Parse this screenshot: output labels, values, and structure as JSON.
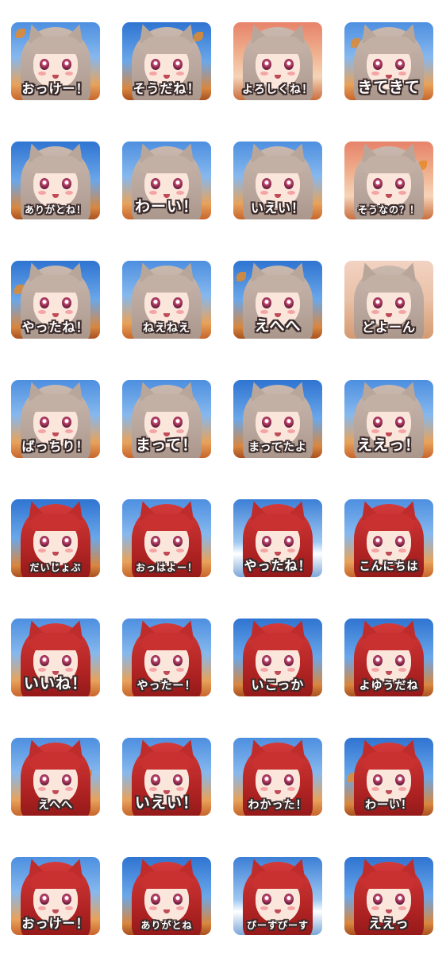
{
  "stickers": [
    {
      "label": "おっけー！",
      "hair": "ash",
      "sky": "sky-a"
    },
    {
      "label": "そうだね！",
      "hair": "ash",
      "sky": "sky-b"
    },
    {
      "label": "よろしくね！",
      "hair": "ash",
      "sky": "sky-c"
    },
    {
      "label": "きてきて",
      "hair": "ash",
      "sky": "sky-a"
    },
    {
      "label": "ありがとね！",
      "hair": "ash",
      "sky": "sky-b"
    },
    {
      "label": "わーい！",
      "hair": "ash",
      "sky": "sky-a"
    },
    {
      "label": "いえい！",
      "hair": "ash",
      "sky": "sky-a"
    },
    {
      "label": "そうなの？！",
      "hair": "ash",
      "sky": "sky-c"
    },
    {
      "label": "やったね！",
      "hair": "ash",
      "sky": "sky-b"
    },
    {
      "label": "ねえねえ",
      "hair": "ash",
      "sky": "sky-a"
    },
    {
      "label": "えへへ",
      "hair": "ash",
      "sky": "sky-b"
    },
    {
      "label": "どよーん",
      "hair": "ash",
      "sky": "sky-d"
    },
    {
      "label": "ばっちり！",
      "hair": "ash",
      "sky": "sky-a"
    },
    {
      "label": "まって！",
      "hair": "ash",
      "sky": "sky-a"
    },
    {
      "label": "まってたよ",
      "hair": "ash",
      "sky": "sky-b"
    },
    {
      "label": "ええっ！",
      "hair": "ash",
      "sky": "sky-a"
    },
    {
      "label": "だいじょぶ",
      "hair": "red",
      "sky": "sky-b"
    },
    {
      "label": "おっはよー！",
      "hair": "red",
      "sky": "sky-a"
    },
    {
      "label": "やったね！",
      "hair": "red",
      "sky": "sky-e"
    },
    {
      "label": "こんにちは",
      "hair": "red",
      "sky": "sky-a"
    },
    {
      "label": "いいね！",
      "hair": "red",
      "sky": "sky-a"
    },
    {
      "label": "やったー！",
      "hair": "red",
      "sky": "sky-a"
    },
    {
      "label": "いこっか",
      "hair": "red",
      "sky": "sky-b"
    },
    {
      "label": "よゆうだね",
      "hair": "red",
      "sky": "sky-b"
    },
    {
      "label": "えへへ",
      "hair": "red",
      "sky": "sky-a"
    },
    {
      "label": "いえい！",
      "hair": "red",
      "sky": "sky-a"
    },
    {
      "label": "わかった！",
      "hair": "red",
      "sky": "sky-a"
    },
    {
      "label": "わーい！",
      "hair": "red",
      "sky": "sky-b"
    },
    {
      "label": "おっけー！",
      "hair": "red",
      "sky": "sky-a"
    },
    {
      "label": "ありがとね",
      "hair": "red",
      "sky": "sky-b"
    },
    {
      "label": "ぴーすぴーす",
      "hair": "red",
      "sky": "sky-e"
    },
    {
      "label": "ええっ",
      "hair": "red",
      "sky": "sky-b"
    }
  ]
}
